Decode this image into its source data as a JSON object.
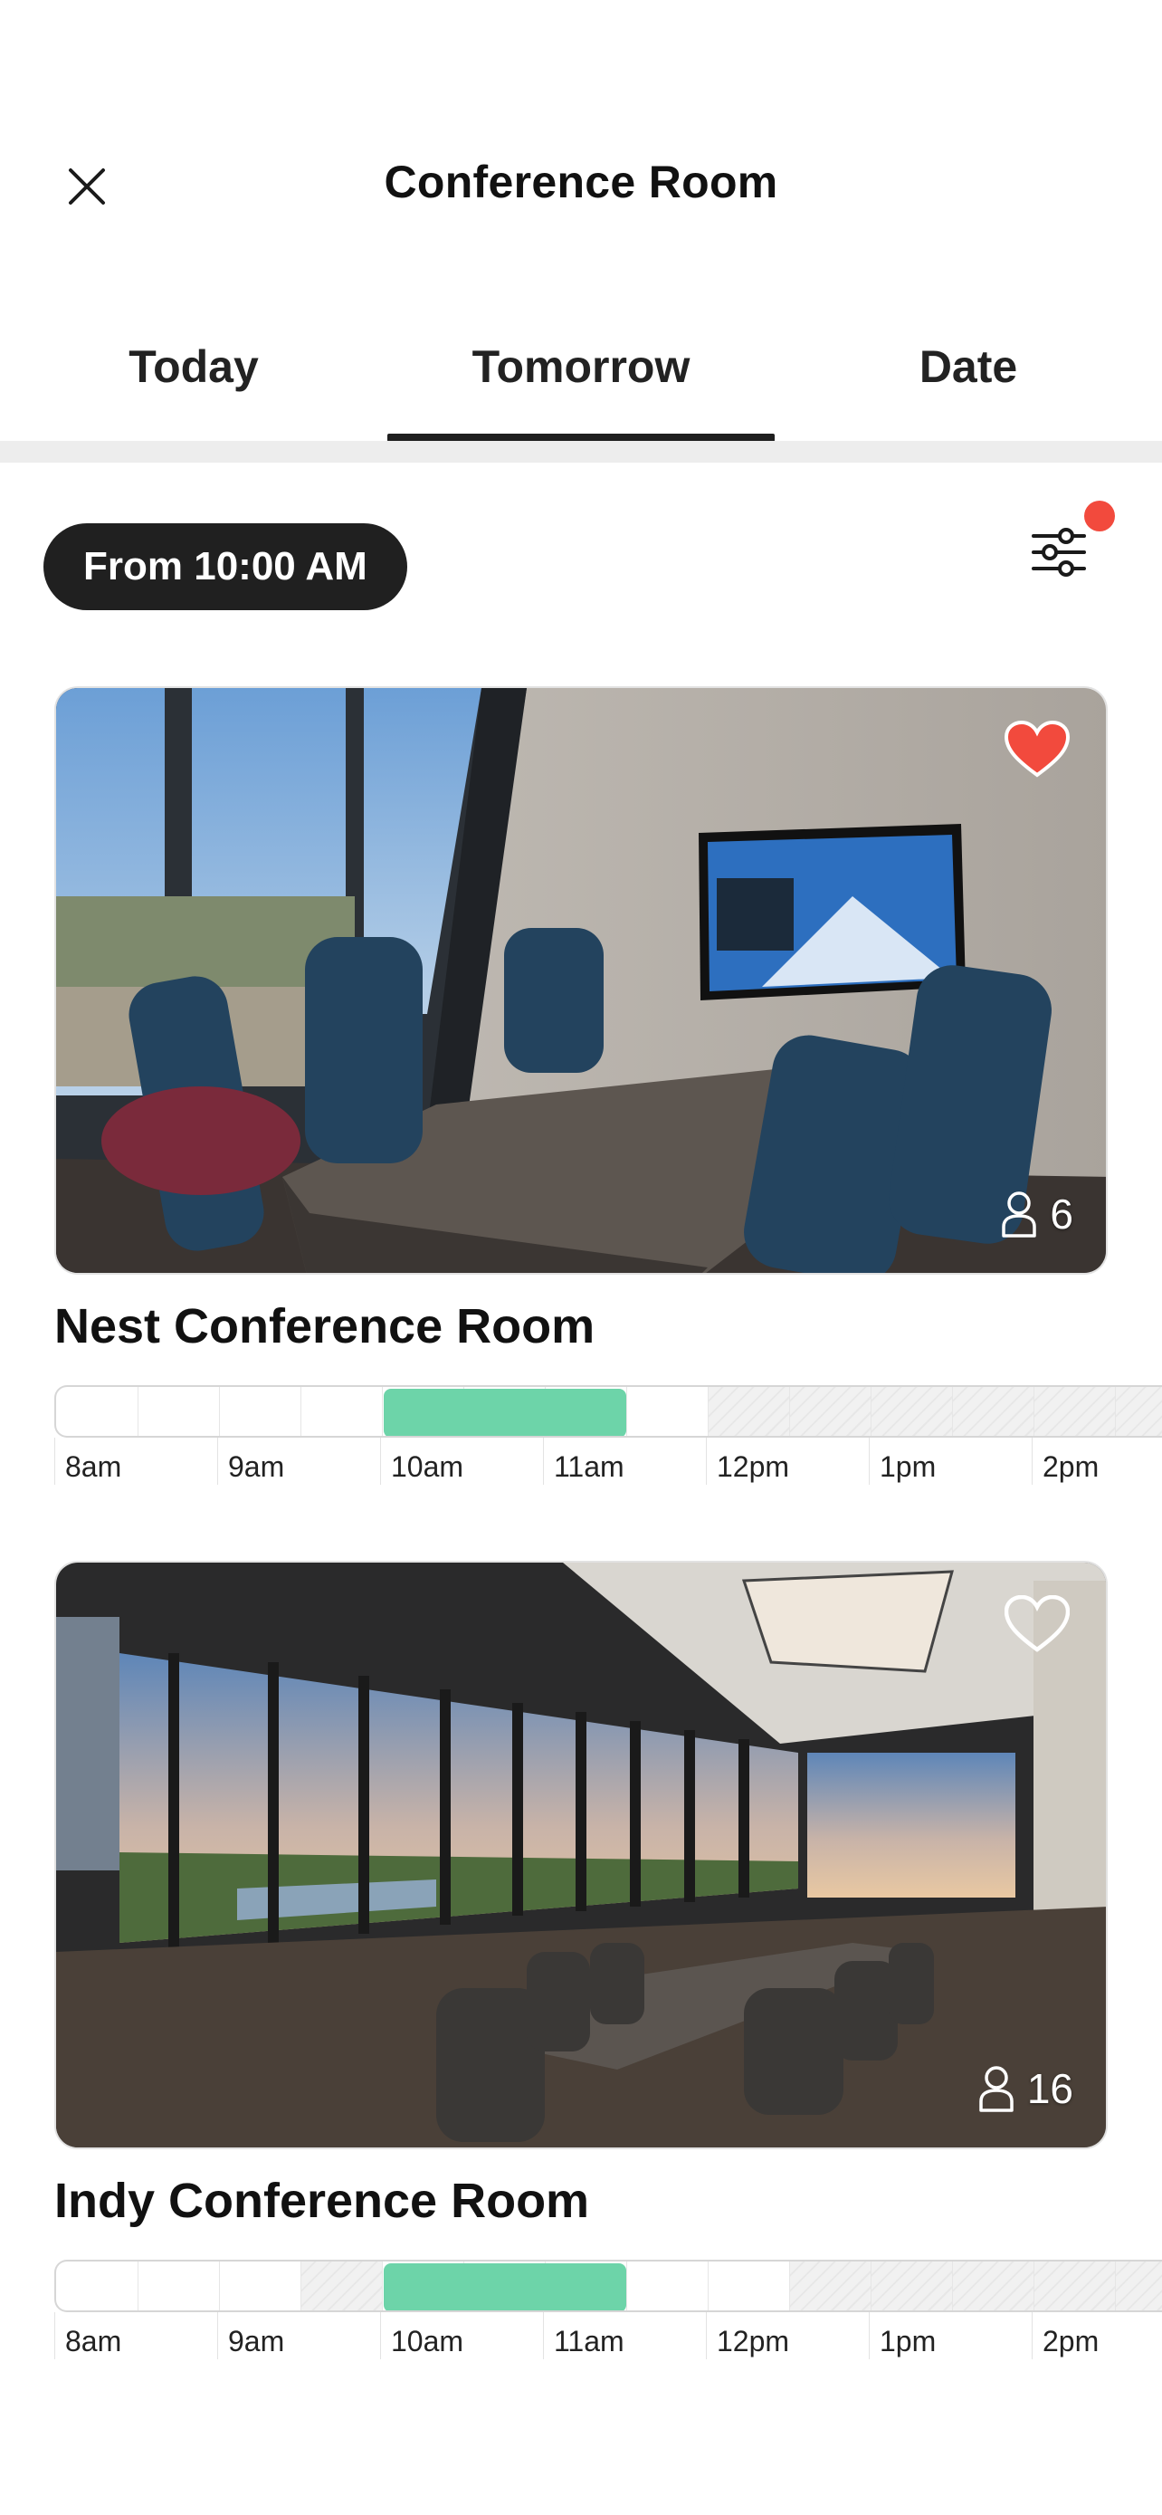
{
  "header": {
    "title": "Conference Room",
    "close_icon": "close-icon"
  },
  "tabs": [
    {
      "label": "Today",
      "active": false
    },
    {
      "label": "Tomorrow",
      "active": true
    },
    {
      "label": "Date",
      "active": false
    }
  ],
  "filter": {
    "from_label": "From 10:00 AM",
    "filter_icon": "sliders-icon",
    "indicator_color": "#f24a3d"
  },
  "colors": {
    "accent_green": "#6dd4a9",
    "pill_bg": "#202020",
    "favorite_red": "#f24a3d"
  },
  "rooms": [
    {
      "name": "Nest Conference Room",
      "capacity": "6",
      "favorite": true,
      "timeline": {
        "labels": [
          "8am",
          "9am",
          "10am",
          "11am",
          "12pm",
          "1pm",
          "2pm"
        ],
        "selected_start": "10am",
        "selected_end": "11:30am",
        "unavailable_from": "12pm"
      }
    },
    {
      "name": "Indy Conference Room",
      "capacity": "16",
      "favorite": false,
      "timeline": {
        "labels": [
          "8am",
          "9am",
          "10am",
          "11am",
          "12pm",
          "1pm",
          "2pm"
        ],
        "selected_start": "10am",
        "selected_end": "11:30am",
        "unavailable_ranges": [
          "9:30am-10am",
          "12:30pm-"
        ]
      }
    }
  ]
}
